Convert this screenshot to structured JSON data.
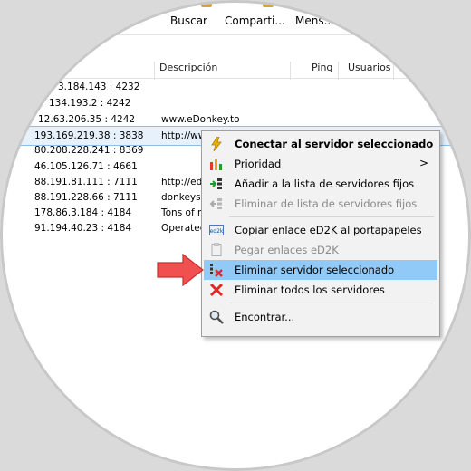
{
  "toolbar": {
    "buscar": "Buscar",
    "compartir": "Comparti...",
    "mensajes": "Mens..."
  },
  "columns": {
    "descripcion": "Descripción",
    "ping": "Ping",
    "usuarios": "Usuarios"
  },
  "servers": [
    {
      "ip": "3.184.143 : 4232",
      "desc": ""
    },
    {
      "ip": "134.193.2 : 4242",
      "desc": ""
    },
    {
      "ip": "12.63.206.35 : 4242",
      "desc": "www.eDonkey.to"
    },
    {
      "ip": "193.169.219.38 : 3838",
      "desc": "http://ww"
    },
    {
      "ip": "80.208.228.241 : 8369",
      "desc": ""
    },
    {
      "ip": "46.105.126.71 : 4661",
      "desc": ""
    },
    {
      "ip": "88.191.81.111 : 7111",
      "desc": "http://edl"
    },
    {
      "ip": "88.191.228.66 : 7111",
      "desc": "donkeys b"
    },
    {
      "ip": "178.86.3.184 : 4184",
      "desc": "Tons of m"
    },
    {
      "ip": "91.194.40.23 : 4184",
      "desc": "Operated"
    }
  ],
  "menu": {
    "connect": "Conectar al servidor seleccionado",
    "priority": "Prioridad",
    "priority_arrow": ">",
    "add_static": "Añadir a la lista de servidores fijos",
    "remove_static": "Eliminar de lista de servidores fijos",
    "copy_link": "Copiar enlace eD2K al portapapeles",
    "paste_links": "Pegar enlaces eD2K",
    "delete_selected": "Eliminar servidor seleccionado",
    "delete_all": "Eliminar todos los servidores",
    "find": "Encontrar..."
  },
  "icons": {
    "connect": "lightning-icon",
    "priority": "bar-chart-icon",
    "add_static": "add-list-icon",
    "remove_static": "remove-list-icon",
    "copy_link": "ed2k-link-icon",
    "paste_links": "ed2k-paste-icon",
    "delete_selected": "delete-server-icon",
    "delete_all": "red-x-icon",
    "find": "magnifier-icon",
    "ed2k_badge": "ed2k"
  },
  "colors": {
    "menu_highlight": "#91c9f7",
    "pointer_arrow": "#f05050",
    "selected_row": "#e7f1fb"
  }
}
